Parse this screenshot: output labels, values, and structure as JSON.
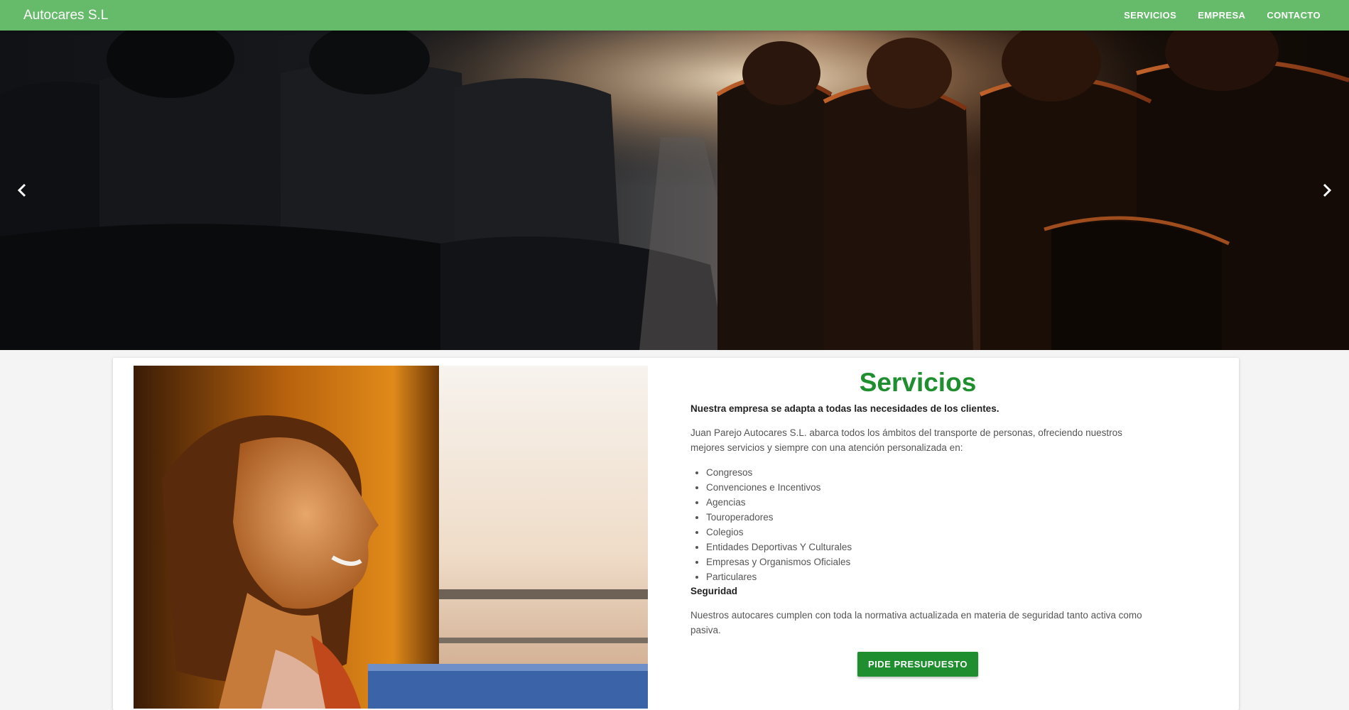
{
  "navbar": {
    "brand": "Autocares S.L",
    "links": [
      "SERVICIOS",
      "EMPRESA",
      "CONTACTO"
    ]
  },
  "hero": {
    "prev_icon": "chevron-left-icon",
    "next_icon": "chevron-right-icon"
  },
  "section": {
    "title": "Servicios",
    "lead": "Nuestra empresa se adapta a todas las necesidades de los clientes.",
    "intro": "Juan Parejo Autocares S.L. abarca todos los ámbitos del transporte de personas, ofreciendo nuestros mejores servicios y siempre con una atención personalizada en:",
    "services": [
      "Congresos",
      "Convenciones e Incentivos",
      "Agencias",
      "Touroperadores",
      "Colegios",
      "Entidades Deportivas Y Culturales",
      "Empresas y Organismos Oficiales",
      "Particulares"
    ],
    "safety_heading": "Seguridad",
    "safety_text": "Nuestros autocares cumplen con toda la normativa actualizada en materia de seguridad tanto activa como pasiva.",
    "cta_label": "PIDE PRESUPUESTO"
  },
  "colors": {
    "navbar": "#66bb6a",
    "accent": "#1e8e2e",
    "background": "#f4f4f4"
  }
}
